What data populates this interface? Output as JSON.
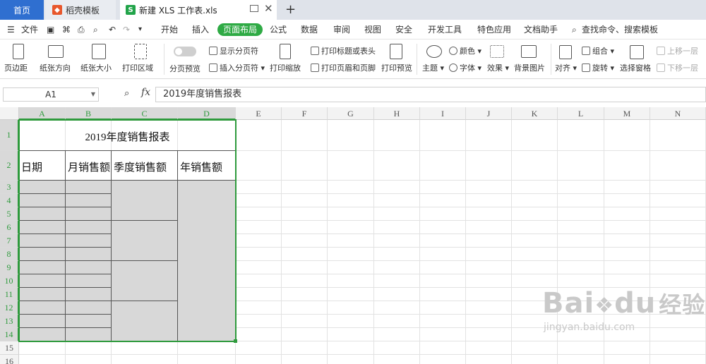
{
  "tabs": {
    "home": "首页",
    "template": "稻壳模板",
    "doc": "新建 XLS 工作表.xls",
    "add": "+"
  },
  "menu": {
    "file": "文件",
    "items": [
      "开始",
      "插入",
      "页面布局",
      "公式",
      "数据",
      "审阅",
      "视图",
      "安全",
      "开发工具",
      "特色应用",
      "文档助手"
    ],
    "active_index": 2,
    "search": "查找命令、搜索模板"
  },
  "ribbon": {
    "margin": "页边距",
    "orientation": "纸张方向",
    "size": "纸张大小",
    "print_area": "打印区域",
    "page_break_preview": "分页预览",
    "show_page_break": "显示分页符",
    "insert_page_break": "插入分页符",
    "print_zoom": "打印缩放",
    "print_titles": "打印标题或表头",
    "header_footer": "打印页眉和页脚",
    "print_preview": "打印预览",
    "theme": "主题",
    "color": "颜色",
    "font": "字体",
    "effect": "效果",
    "background": "背景图片",
    "align": "对齐",
    "group": "组合",
    "rotate": "旋转",
    "selection_pane": "选择窗格",
    "bring_forward": "上移一层",
    "send_backward": "下移一层"
  },
  "formula_bar": {
    "name_box": "A1",
    "fx": "fx",
    "content": "2019年度销售报表"
  },
  "sheet": {
    "columns": [
      "A",
      "B",
      "C",
      "D",
      "E",
      "F",
      "G",
      "H",
      "I",
      "J",
      "K",
      "L",
      "M",
      "N"
    ],
    "rows": [
      "1",
      "2",
      "3",
      "4",
      "5",
      "6",
      "7",
      "8",
      "9",
      "10",
      "11",
      "12",
      "13",
      "14",
      "15",
      "16"
    ],
    "title": "2019年度销售报表",
    "headers": [
      "日期",
      "月销售额",
      "季度销售额",
      "年销售额"
    ]
  },
  "watermark": {
    "brand": "Bai",
    "paw": "du",
    "cn": "经验",
    "url": "jingyan.baidu.com"
  },
  "colors": {
    "accent": "#2eaa44",
    "home_tab": "#2f6fd0",
    "selection": "#2e9a3c",
    "shaded_cell": "#d8d8d8"
  }
}
